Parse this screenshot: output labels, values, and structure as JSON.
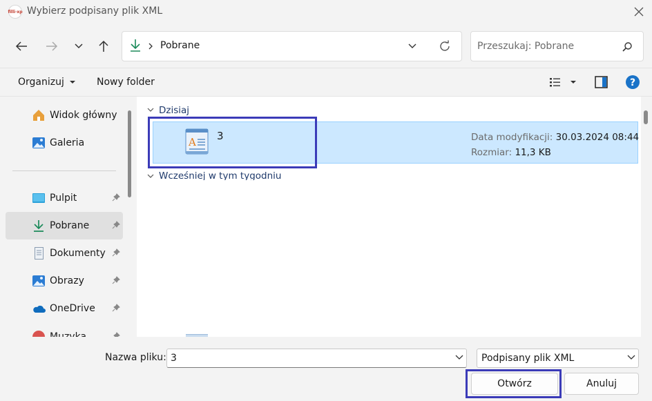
{
  "window": {
    "title": "Wybierz podpisany plik XML",
    "app_logo_text": "filli·xp"
  },
  "address": {
    "location": "Pobrane"
  },
  "search": {
    "placeholder": "Przeszukaj: Pobrane"
  },
  "toolbar": {
    "organize": "Organizuj",
    "new_folder": "Nowy folder"
  },
  "sidebar": {
    "items": [
      {
        "label": "Widok główny",
        "icon": "home-icon"
      },
      {
        "label": "Galeria",
        "icon": "gallery-icon"
      },
      {
        "label": "Pulpit",
        "icon": "desktop-icon",
        "pinned": true
      },
      {
        "label": "Pobrane",
        "icon": "download-icon",
        "pinned": true,
        "active": true
      },
      {
        "label": "Dokumenty",
        "icon": "documents-icon",
        "pinned": true
      },
      {
        "label": "Obrazy",
        "icon": "pictures-icon",
        "pinned": true
      },
      {
        "label": "OneDrive",
        "icon": "onedrive-icon",
        "pinned": true
      },
      {
        "label": "Muzyka",
        "icon": "music-icon",
        "pinned": true
      }
    ]
  },
  "content": {
    "groups": [
      {
        "label": "Dzisiaj"
      },
      {
        "label": "Wcześniej w tym tygodniu"
      }
    ],
    "file": {
      "name": "3",
      "modified_label": "Data modyfikacji:",
      "modified_value": "30.03.2024 08:44",
      "size_label": "Rozmiar:",
      "size_value": "11,3 KB"
    }
  },
  "bottom": {
    "filename_label": "Nazwa pliku:",
    "filename_value": "3",
    "filetype_value": "Podpisany plik XML",
    "open_button": "Otwórz",
    "cancel_button": "Anuluj"
  },
  "colors": {
    "accent": "#0067c0",
    "selection": "#cce8ff",
    "highlight_box": "#3b3bb8"
  }
}
